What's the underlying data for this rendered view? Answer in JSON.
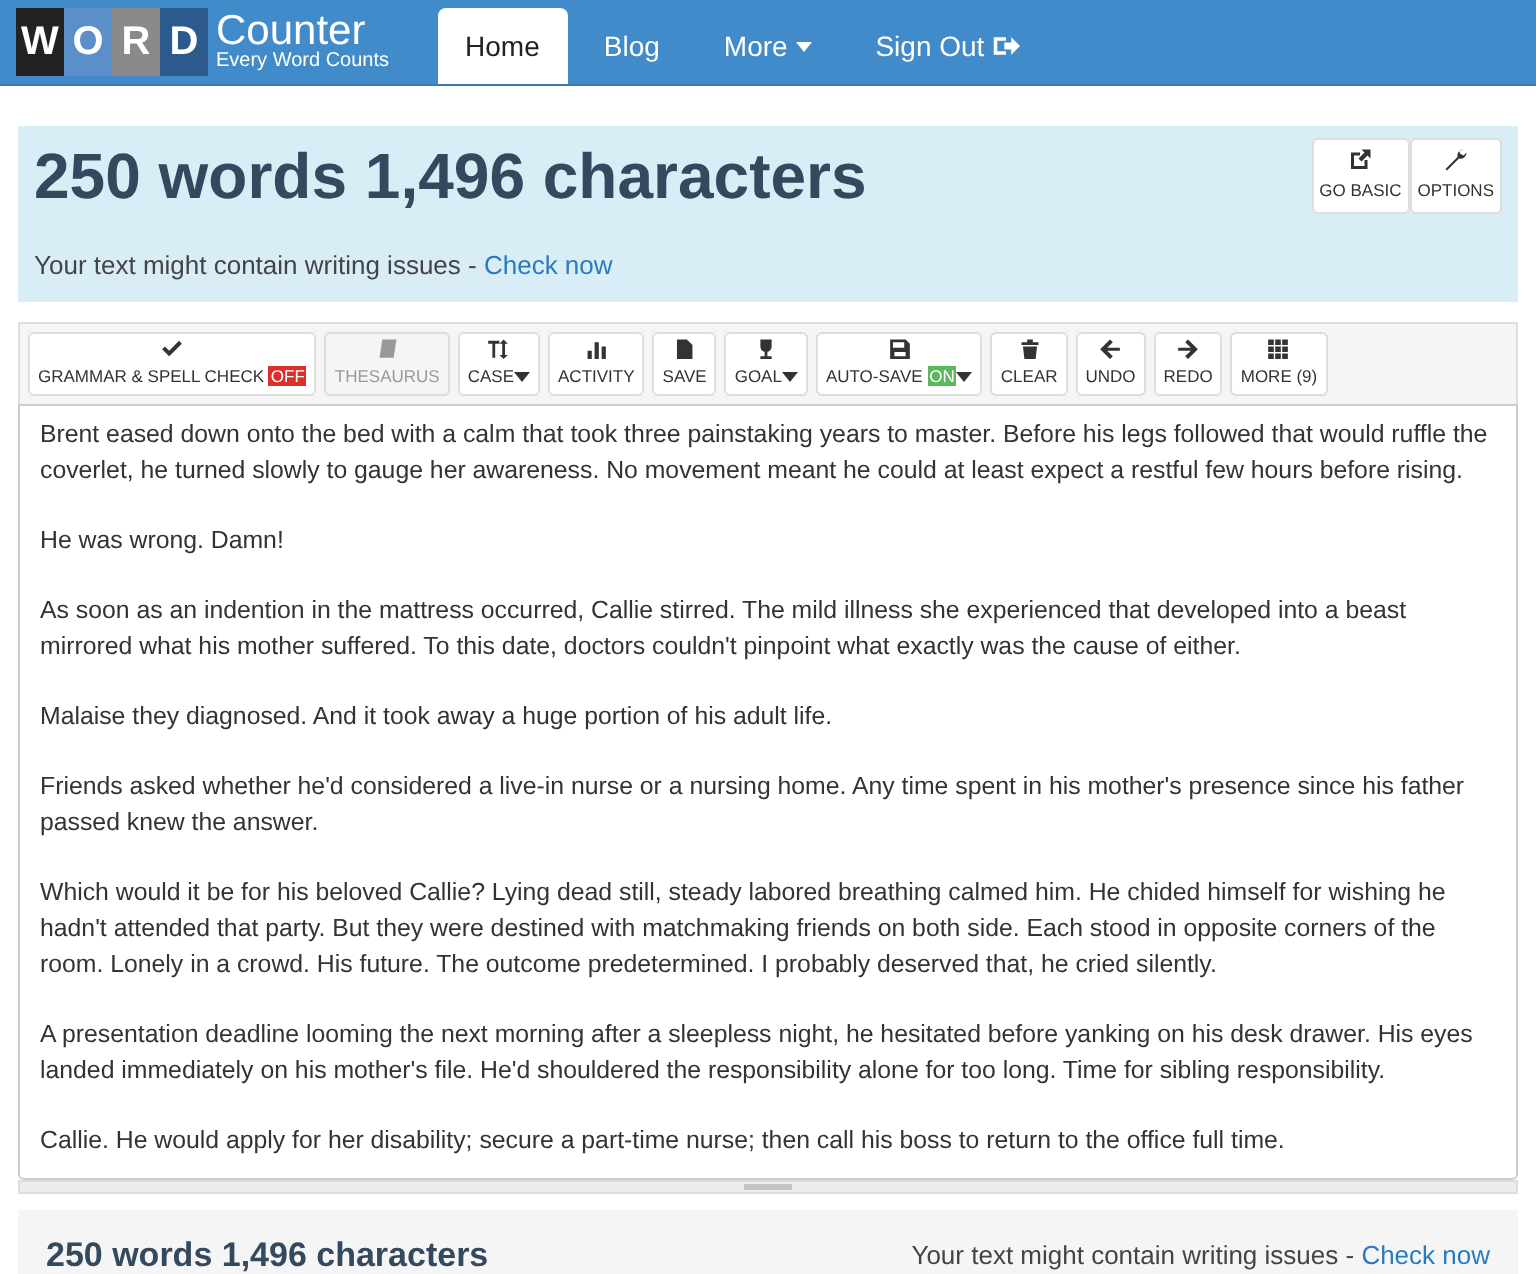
{
  "logo": {
    "letters": [
      {
        "text": "W",
        "color": "#222222"
      },
      {
        "text": "O",
        "color": "#5b8fc9"
      },
      {
        "text": "R",
        "color": "#8a8a8a"
      },
      {
        "text": "D",
        "color": "#2d5a8c"
      }
    ],
    "name": "Counter",
    "tagline": "Every Word Counts"
  },
  "nav": [
    {
      "label": "Home",
      "selected": true,
      "dropdown": false,
      "icon": false
    },
    {
      "label": "Blog",
      "selected": false,
      "dropdown": false,
      "icon": false
    },
    {
      "label": "More",
      "selected": false,
      "dropdown": true,
      "icon": false
    },
    {
      "label": "Sign Out",
      "selected": false,
      "dropdown": false,
      "icon": true
    }
  ],
  "summary": {
    "counts": "250 words 1,496 characters",
    "issues_text": "Your text might contain writing issues - ",
    "issues_link": "Check now",
    "buttons": [
      "GO BASIC",
      "OPTIONS"
    ]
  },
  "toolbar": [
    {
      "label": "GRAMMAR & SPELL CHECK",
      "disabled": false,
      "dropdown": false,
      "badge": {
        "text": "OFF",
        "on": false
      }
    },
    {
      "label": "THESAURUS",
      "disabled": true,
      "dropdown": false
    },
    {
      "label": "CASE",
      "disabled": false,
      "dropdown": true
    },
    {
      "label": "ACTIVITY",
      "disabled": false,
      "dropdown": false
    },
    {
      "label": "SAVE",
      "disabled": false,
      "dropdown": false
    },
    {
      "label": "GOAL",
      "disabled": false,
      "dropdown": true
    },
    {
      "label": "AUTO-SAVE",
      "disabled": false,
      "dropdown": true,
      "badge": {
        "text": "ON",
        "on": true
      }
    },
    {
      "label": "CLEAR",
      "disabled": false,
      "dropdown": false
    },
    {
      "label": "UNDO",
      "disabled": false,
      "dropdown": false
    },
    {
      "label": "REDO",
      "disabled": false,
      "dropdown": false
    },
    {
      "label": "MORE (9)",
      "disabled": false,
      "dropdown": false
    }
  ],
  "editor": [
    "Brent eased down onto the bed with a calm that took three painstaking years to master. Before his legs followed that would ruffle the coverlet, he turned slowly to gauge her awareness. No movement meant he could at least expect a restful few hours before rising.",
    "He was wrong. Damn!",
    "As soon as an indention in the mattress occurred, Callie stirred. The mild illness she experienced that developed into a beast mirrored what his mother suffered. To this date, doctors couldn't pinpoint what exactly was the cause of either.",
    "Malaise they diagnosed. And it took away a huge portion of his adult life.",
    "Friends asked whether he'd considered a live-in nurse or a nursing home. Any time spent in his mother's presence since his father passed knew the answer.",
    "Which would it be for his beloved Callie? Lying dead still, steady labored breathing calmed him. He chided himself for wishing he hadn't attended that party. But they were destined with matchmaking friends on both side. Each stood in opposite corners of the room. Lonely in a crowd.  His future. The outcome predetermined. I probably deserved that, he cried silently.",
    "A presentation deadline looming the next morning after a sleepless night, he hesitated before yanking on his desk drawer. His eyes landed immediately on his mother's file. He'd shouldered the responsibility alone for too long. Time for sibling responsibility.",
    "Callie. He would apply for her disability; secure a part-time nurse; then call his boss to return to the office full time."
  ],
  "footer": {
    "counts": "250 words 1,496 characters",
    "issues_text": "Your text might contain writing issues - ",
    "issues_link": "Check now"
  }
}
